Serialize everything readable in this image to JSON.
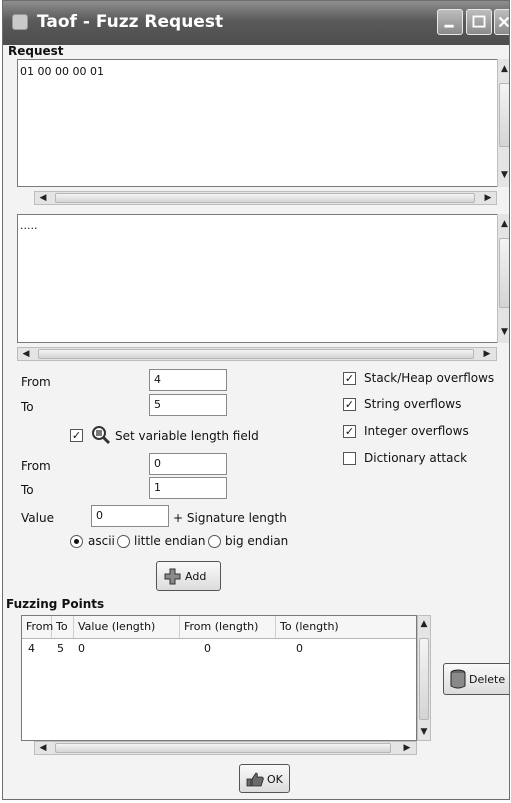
{
  "window": {
    "title": "Taof - Fuzz Request"
  },
  "request": {
    "label": "Request",
    "hex_text": "01 00 00 00 01",
    "ascii_text": "....."
  },
  "range": {
    "from_label": "From",
    "from_value": "4",
    "to_label": "To",
    "to_value": "5"
  },
  "variable_length": {
    "checked": true,
    "label": "Set variable length field",
    "from_label": "From",
    "from_value": "0",
    "to_label": "To",
    "to_value": "1",
    "value_label": "Value",
    "value_value": "0",
    "signature_label": "+ Signature length",
    "encoding_options": [
      "ascii",
      "little endian",
      "big endian"
    ],
    "encoding_selected": "ascii"
  },
  "add_button": {
    "label": "Add"
  },
  "options": [
    {
      "label": "Stack/Heap overflows",
      "checked": true
    },
    {
      "label": "String overflows",
      "checked": true
    },
    {
      "label": "Integer overflows",
      "checked": true
    },
    {
      "label": "Dictionary attack",
      "checked": false
    }
  ],
  "fuzzing_points": {
    "label": "Fuzzing Points",
    "columns": [
      "From",
      "To",
      "Value (length)",
      "From (length)",
      "To (length)"
    ],
    "rows": [
      [
        "4",
        "5",
        "0",
        "0",
        "0"
      ]
    ]
  },
  "delete_button": {
    "label": "Delete"
  },
  "ok_button": {
    "label": "OK"
  }
}
